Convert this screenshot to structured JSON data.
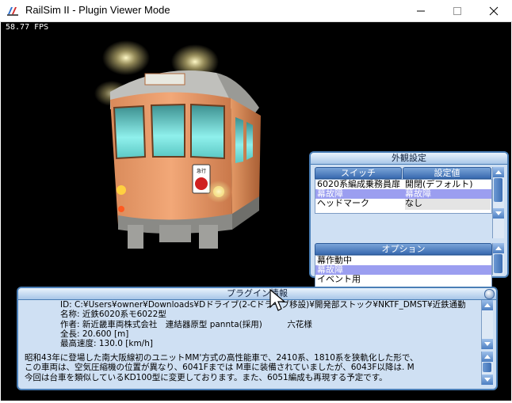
{
  "window": {
    "title": "RailSim II - Plugin Viewer Mode",
    "app_icon": "railsim-icon",
    "controls": [
      "minimize-icon",
      "maximize-icon",
      "close-icon"
    ]
  },
  "viewport": {
    "fps": "58.77 FPS"
  },
  "exterior_panel": {
    "title": "外観設定",
    "switch_header": "スイッチ",
    "value_header": "設定値",
    "switch_rows": [
      {
        "switch": "6020系編成乗務員扉",
        "value": "開閉(デフォルト)",
        "selected": false
      },
      {
        "switch": "幕故障",
        "value": "幕故障",
        "selected": true
      },
      {
        "switch": "ヘッドマーク",
        "value": "なし",
        "selected": false
      }
    ],
    "option_header": "オプション",
    "option_rows": [
      {
        "label": "幕作動中",
        "selected": false
      },
      {
        "label": "幕故障",
        "selected": true
      },
      {
        "label": "イベント用",
        "selected": false
      }
    ]
  },
  "plugin_panel": {
    "title": "プラグイン情報",
    "meta": [
      "ID: C:¥Users¥owner¥Downloads¥Dドライブ(2-Cドライブ移設)¥開発部ストック¥NKTF_DMST¥近鉄通勤",
      "名称: 近鉄6020系モ6022型",
      "作者: 新近畿車両株式会社　連結器原型 pannta(採用)　　　六花様",
      "全長: 20.600 [m]",
      "最高速度: 130.0 [km/h]"
    ],
    "description": [
      "昭和43年に登場した南大阪線初のユニットMM'方式の高性能車で、2410系、1810系を狭軌化した形で、",
      "この車両は、空気圧縮機の位置が異なり、6041Fまでは M車に装備されていましたが、6043F以降は. M",
      "今回は台車を類似しているKD100型に変更しております。また、6051編成も再現する予定です。"
    ]
  },
  "colors": {
    "panel_border": "#4a7eb6",
    "panel_bg": "#cfe0f3",
    "selection": "#9b9ef0",
    "train_body": "#e09060"
  }
}
